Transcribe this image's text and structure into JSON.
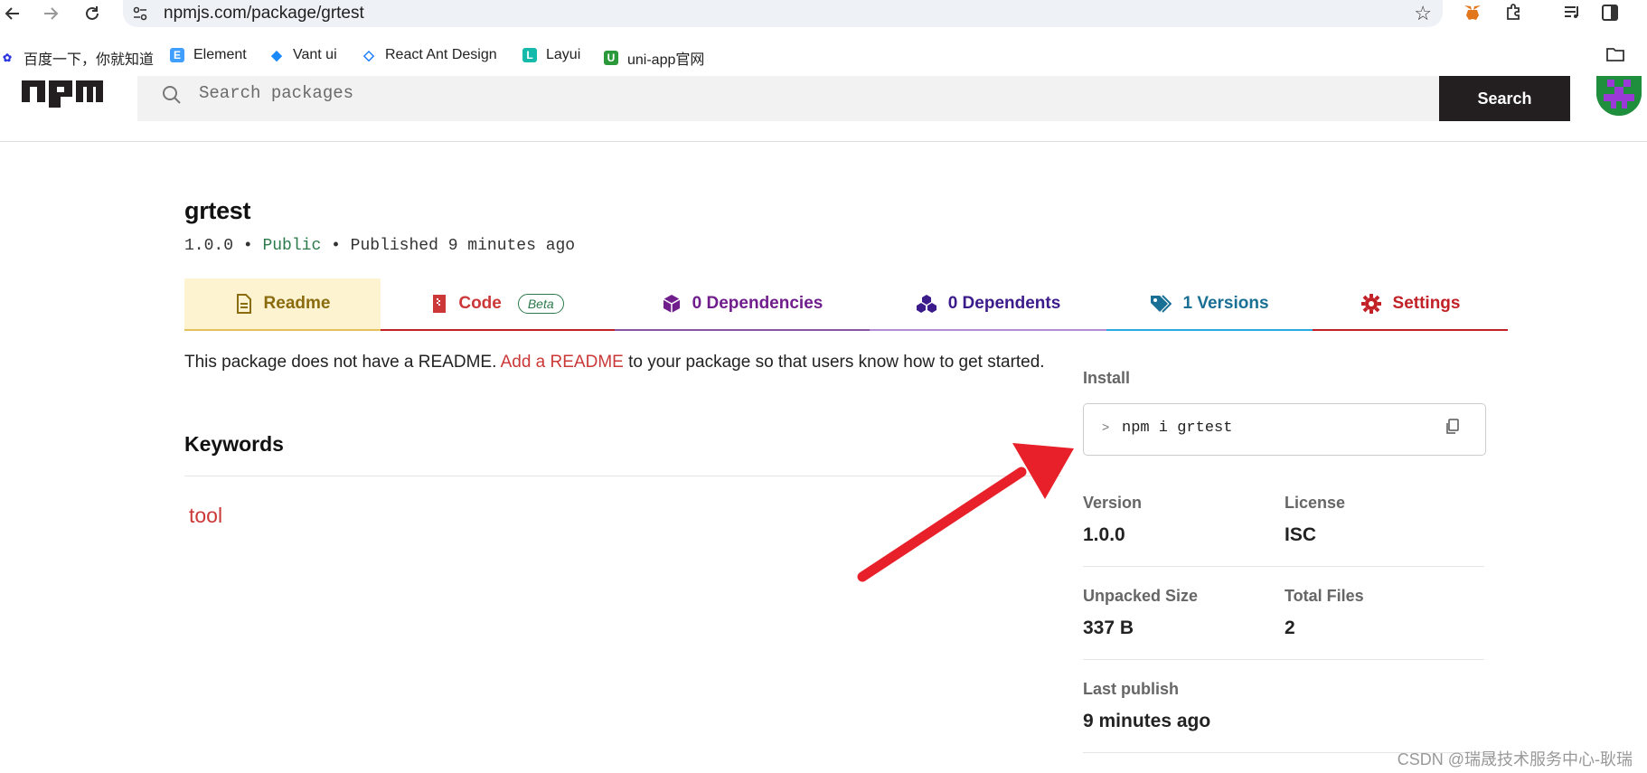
{
  "browser": {
    "url": "npmjs.com/package/grtest",
    "bookmarks": [
      {
        "label": "百度一下，你就知道",
        "icon": "baidu-icon"
      },
      {
        "label": "Element",
        "icon": "element-icon"
      },
      {
        "label": "Vant ui",
        "icon": "vant-icon"
      },
      {
        "label": "React Ant Design",
        "icon": "antd-icon"
      },
      {
        "label": "Layui",
        "icon": "layui-icon"
      },
      {
        "label": "uni-app官网",
        "icon": "uniapp-icon"
      }
    ]
  },
  "header": {
    "search_placeholder": "Search packages",
    "search_button": "Search"
  },
  "package": {
    "name": "grtest",
    "version": "1.0.0",
    "visibility": "Public",
    "published": "Published 9 minutes ago"
  },
  "tabs": [
    {
      "label": "Readme",
      "icon": "readme-icon",
      "color": "#8a6c0f"
    },
    {
      "label": "Code",
      "icon": "code-icon",
      "color": "#cb3837",
      "badge": "Beta"
    },
    {
      "label": "0 Dependencies",
      "icon": "box-icon",
      "color": "#6f1e8c"
    },
    {
      "label": "0 Dependents",
      "icon": "boxes-icon",
      "color": "#3b1b8c"
    },
    {
      "label": "1 Versions",
      "icon": "tags-icon",
      "color": "#1a6f94"
    },
    {
      "label": "Settings",
      "icon": "gear-icon",
      "color": "#c12127"
    }
  ],
  "readme": {
    "prefix": "This package does not have a README.",
    "link": "Add a README",
    "suffix": "to your package so that users know how to get started."
  },
  "keywords": {
    "title": "Keywords",
    "items": [
      "tool"
    ]
  },
  "sidebar": {
    "install_label": "Install",
    "install_prompt": ">",
    "install_command": "npm i grtest",
    "version_label": "Version",
    "version_value": "1.0.0",
    "license_label": "License",
    "license_value": "ISC",
    "unpacked_label": "Unpacked Size",
    "unpacked_value": "337 B",
    "files_label": "Total Files",
    "files_value": "2",
    "last_publish_label": "Last publish",
    "last_publish_value": "9 minutes ago"
  },
  "watermark": "CSDN @瑞晟技术服务中心-耿瑞",
  "colors": {
    "npm_red": "#cb3837",
    "readme_tab_bg": "#fdf3d0",
    "public_green": "#2b7a4b",
    "arrow_red": "#e8202a"
  }
}
